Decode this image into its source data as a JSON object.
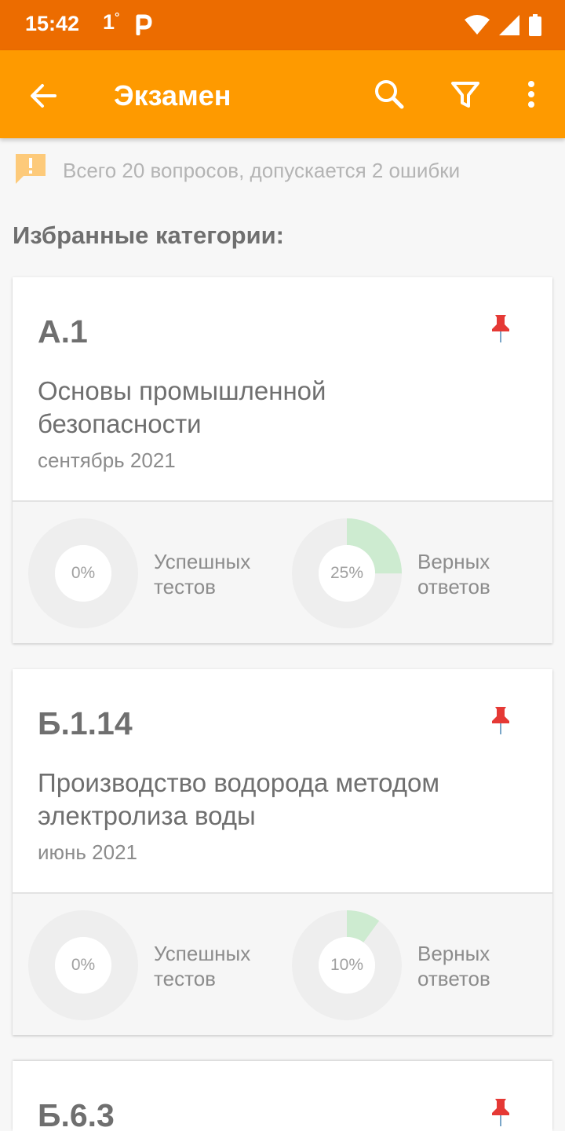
{
  "status_bar": {
    "time": "15:42",
    "temperature": "1",
    "degree": "°",
    "colors": {
      "background": "#ec6c00"
    },
    "icons": [
      "p-logo-icon",
      "wifi-icon",
      "signal-icon",
      "battery-icon"
    ]
  },
  "app_bar": {
    "title": "Экзамен",
    "colors": {
      "background": "#fe9a00"
    },
    "icons": [
      "back-arrow-icon",
      "search-icon",
      "filter-icon",
      "more-vert-icon"
    ]
  },
  "info": {
    "text": "Всего 20 вопросов, допускается 2 ошибки",
    "icon": "alert-bubble-icon"
  },
  "section_title": "Избранные категории:",
  "cards": [
    {
      "code": "А.1",
      "name_line1": "Основы промышленной",
      "name_line2": "безопасности",
      "date": "сентябрь 2021",
      "pinned": true,
      "passed_tests": {
        "percent": 0,
        "label": "0%",
        "line1": "Успешных",
        "line2": "тестов"
      },
      "correct_answers": {
        "percent": 25,
        "label": "25%",
        "line1": "Верных",
        "line2": "ответов"
      }
    },
    {
      "code": "Б.1.14",
      "name_line1": "Производство водорода методом",
      "name_line2": "электролиза воды",
      "date": "июнь 2021",
      "pinned": true,
      "passed_tests": {
        "percent": 0,
        "label": "0%",
        "line1": "Успешных",
        "line2": "тестов"
      },
      "correct_answers": {
        "percent": 10,
        "label": "10%",
        "line1": "Верных",
        "line2": "ответов"
      }
    },
    {
      "code": "Б.6.3",
      "pinned": true
    }
  ],
  "colors": {
    "accent": "#fe9a00",
    "progress": "#cdebd0",
    "track": "#eeeeee",
    "pin": "#e53935"
  }
}
